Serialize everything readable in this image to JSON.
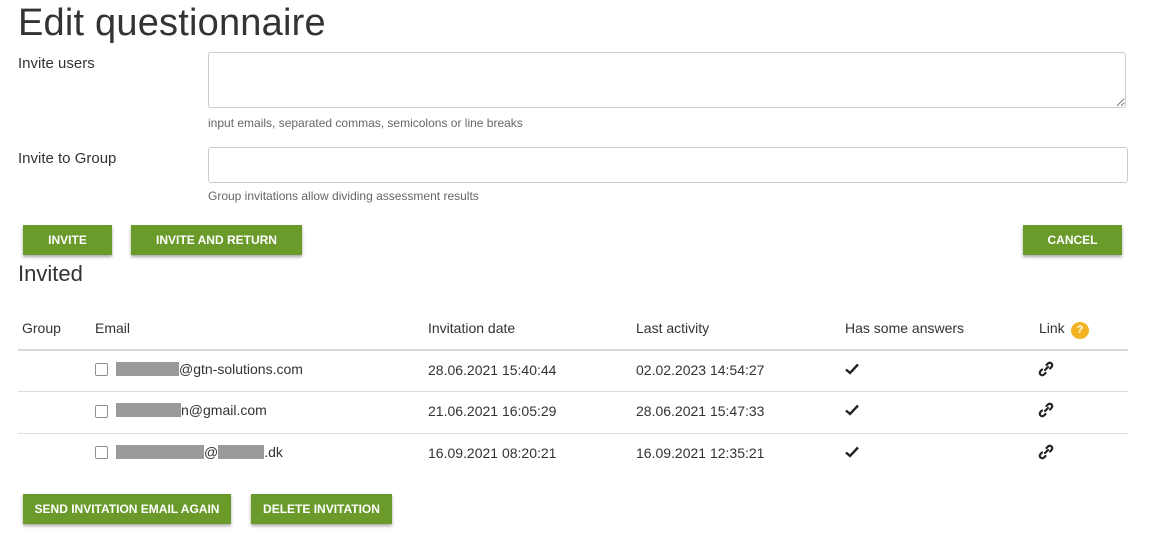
{
  "page": {
    "title": "Edit questionnaire"
  },
  "form": {
    "invite_users_label": "Invite users",
    "invite_users_value": "",
    "invite_users_hint": "input emails, separated commas, semicolons or line breaks",
    "invite_group_label": "Invite to Group",
    "invite_group_value": "",
    "invite_group_hint": "Group invitations allow dividing assessment results"
  },
  "actions": {
    "invite": "INVITE",
    "invite_and_return": "INVITE AND RETURN",
    "cancel": "CANCEL"
  },
  "invited": {
    "title": "Invited",
    "columns": {
      "group": "Group",
      "email": "Email",
      "invitation_date": "Invitation date",
      "last_activity": "Last activity",
      "has_answers": "Has some answers",
      "link": "Link",
      "link_help": "?"
    },
    "rows": [
      {
        "group": "",
        "email_suffix": "@gtn-solutions.com",
        "invitation_date": "28.06.2021 15:40:44",
        "last_activity": "02.02.2023 14:54:27",
        "has_answers": true
      },
      {
        "group": "",
        "email_suffix": "n@gmail.com",
        "invitation_date": "21.06.2021 16:05:29",
        "last_activity": "28.06.2021 15:47:33",
        "has_answers": true
      },
      {
        "group": "",
        "email_mid": "@",
        "email_suffix": ".dk",
        "invitation_date": "16.09.2021 08:20:21",
        "last_activity": "16.09.2021 12:35:21",
        "has_answers": true
      }
    ]
  },
  "bulk_actions": {
    "send_again": "SEND INVITATION EMAIL AGAIN",
    "delete": "DELETE INVITATION"
  },
  "icons": {
    "check": "checkmark-icon",
    "link": "link-icon",
    "help": "help-icon"
  },
  "colors": {
    "button": "#6a9a2a",
    "help_badge": "#f3b323",
    "redaction": "#9a9a9a"
  }
}
